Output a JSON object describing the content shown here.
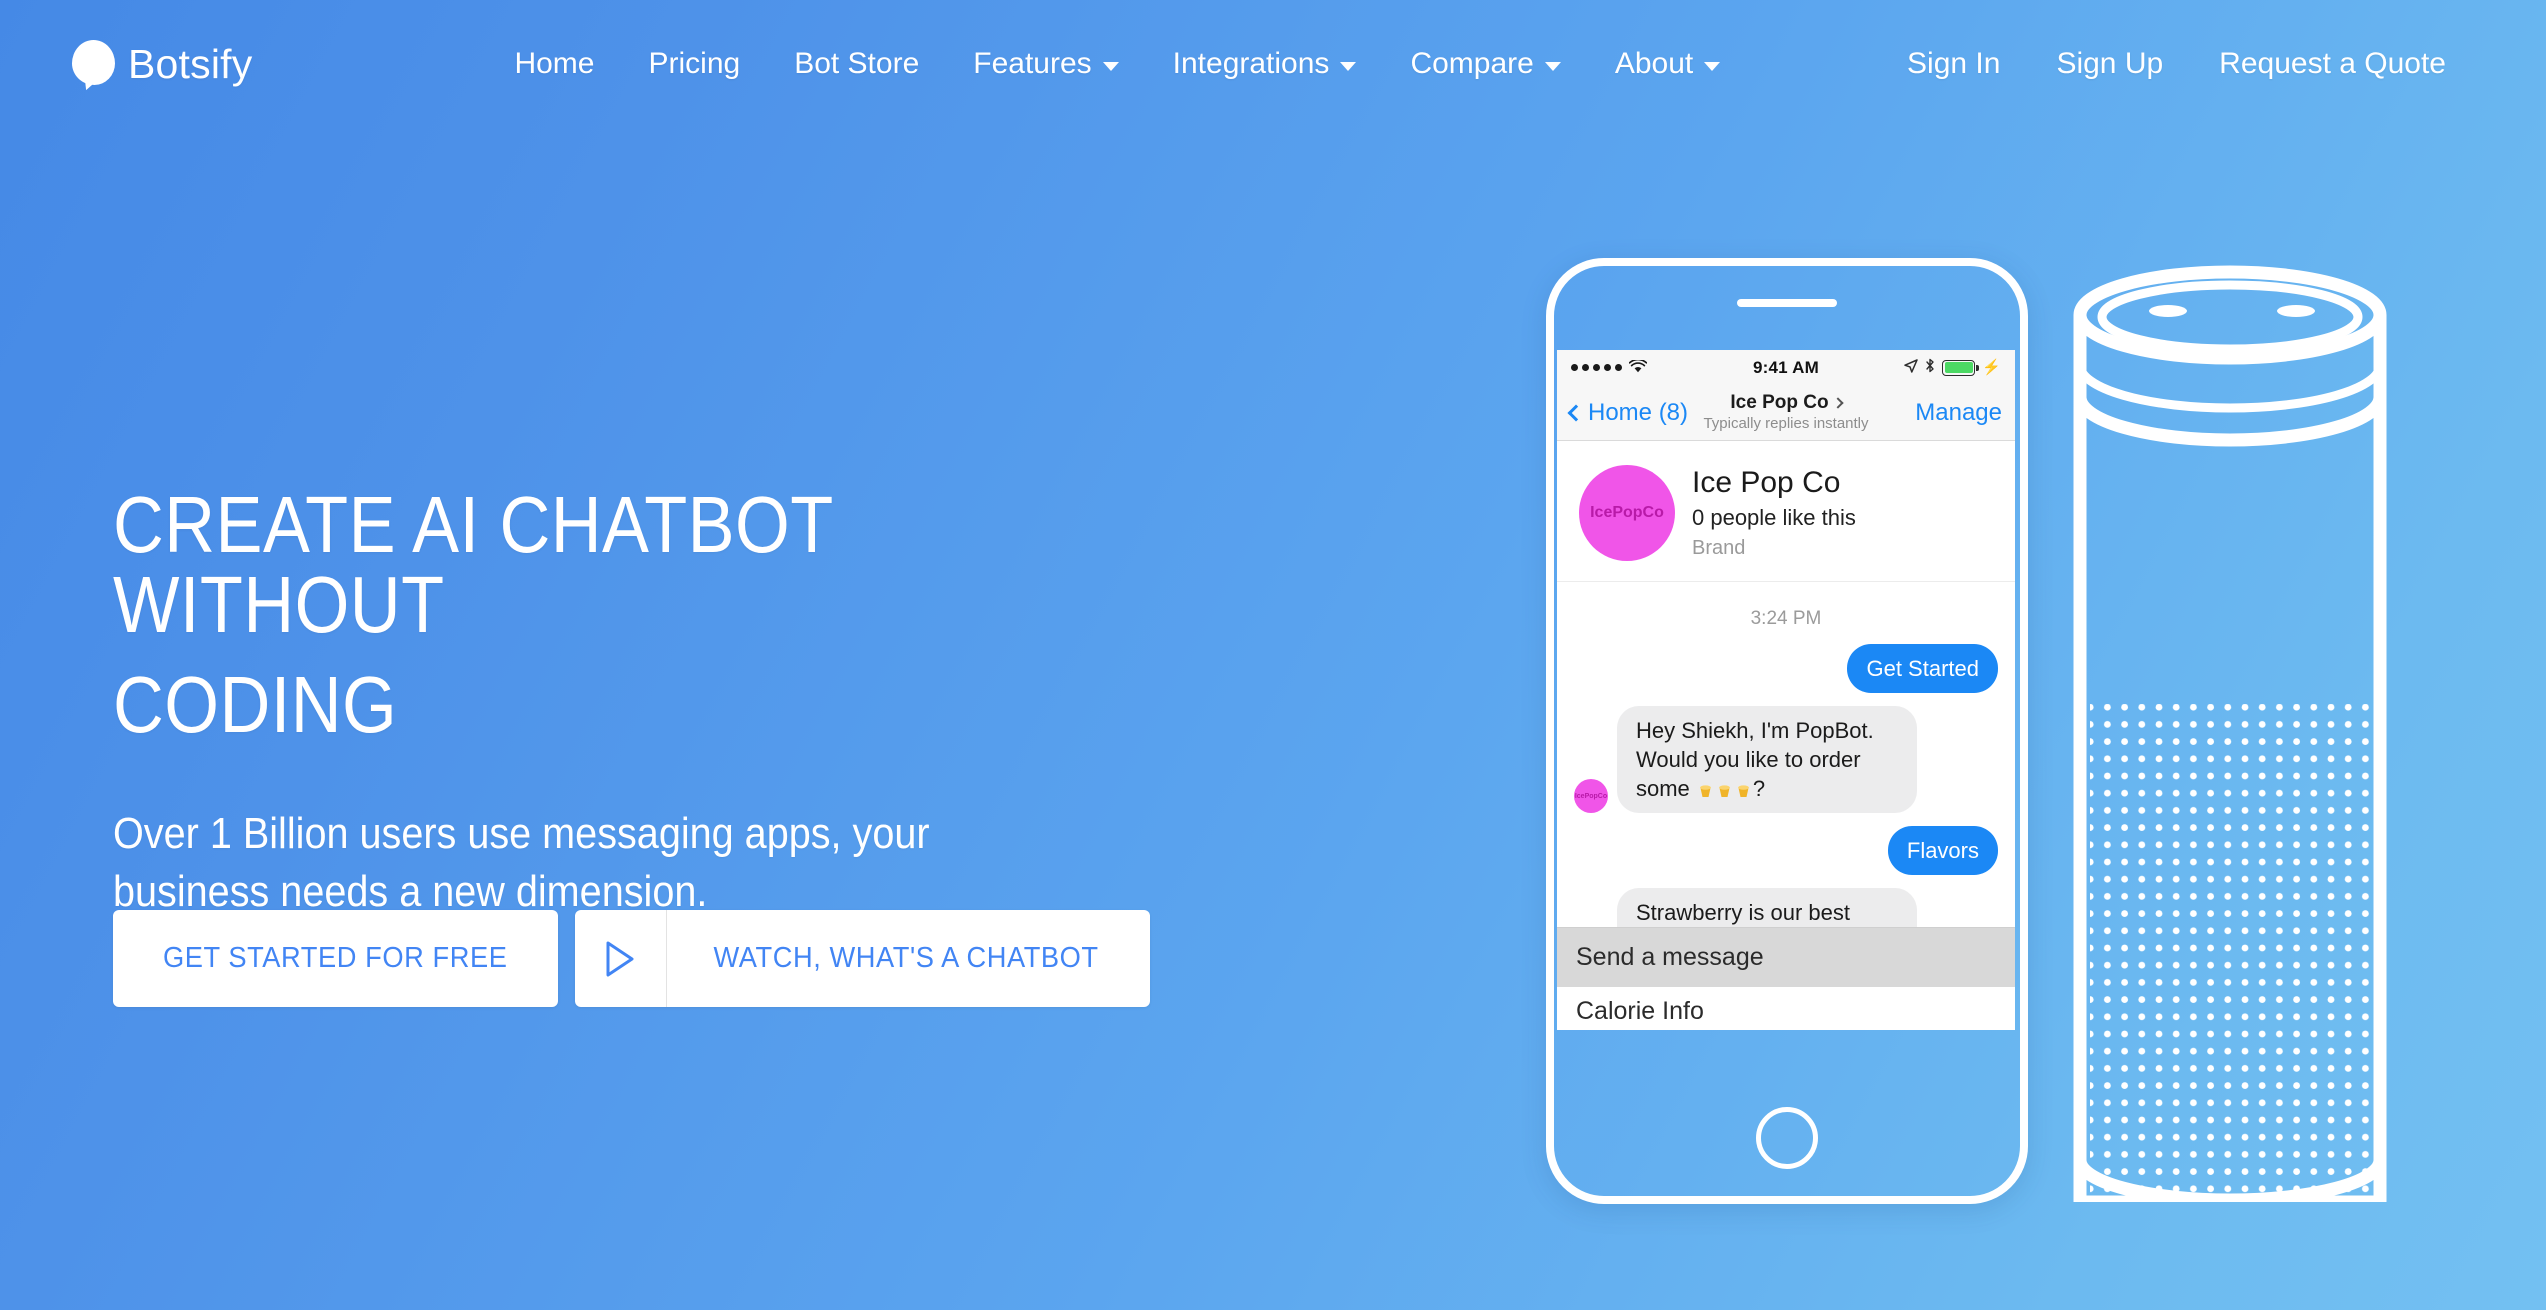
{
  "brand": {
    "name": "Botsify",
    "logo_icon": "chat-bubble-icon"
  },
  "nav": {
    "center_items": [
      {
        "label": "Home",
        "has_dropdown": false
      },
      {
        "label": "Pricing",
        "has_dropdown": false
      },
      {
        "label": "Bot Store",
        "has_dropdown": false
      },
      {
        "label": "Features",
        "has_dropdown": true
      },
      {
        "label": "Integrations",
        "has_dropdown": true
      },
      {
        "label": "Compare",
        "has_dropdown": true
      },
      {
        "label": "About",
        "has_dropdown": true
      }
    ],
    "right_items": [
      {
        "label": "Sign In"
      },
      {
        "label": "Sign Up"
      },
      {
        "label": "Request a Quote"
      }
    ]
  },
  "hero": {
    "headline_line1": "CREATE AI CHATBOT WITHOUT",
    "headline_line2": "CODING",
    "subheadline_line1": "Over 1 Billion users use messaging apps, your",
    "subheadline_line2": "business needs a new dimension.",
    "primary_cta": "GET STARTED FOR FREE",
    "video_cta": "WATCH, WHAT'S A CHATBOT",
    "play_icon": "play-triangle-icon"
  },
  "phone": {
    "status_bar": {
      "signal_dots": 5,
      "wifi_icon": "wifi-icon",
      "time": "9:41 AM",
      "location_icon": "location-arrow-icon",
      "bluetooth_icon": "bluetooth-icon",
      "battery_icon": "battery-icon",
      "charging_icon": "lightning-bolt-icon"
    },
    "messenger_nav": {
      "back_label": "Home (8)",
      "back_icon": "chevron-left-icon",
      "title": "Ice Pop Co",
      "title_chevron": "chevron-right-icon",
      "subtitle": "Typically replies instantly",
      "action_label": "Manage"
    },
    "profile": {
      "avatar_text": "IcePopCo",
      "avatar_color": "#f055e8",
      "name": "Ice Pop Co",
      "likes": "0 people like this",
      "category": "Brand"
    },
    "chat": {
      "timestamp": "3:24 PM",
      "messages": [
        {
          "from": "user",
          "text": "Get Started"
        },
        {
          "from": "bot",
          "text_before": "Hey Shiekh, I'm PopBot. Would you like to order some",
          "emoji_count": 3,
          "text_after": "?",
          "avatar_text": "IcePopCo"
        },
        {
          "from": "user",
          "text": "Flavors"
        },
        {
          "from": "bot",
          "text_before": "Strawberry is our best selling flavour",
          "emoji_count": 0,
          "text_after": "",
          "avatar_text": "IcePopCo"
        }
      ]
    },
    "composer": {
      "input_placeholder": "Send a message",
      "quick_reply": "Calorie Info"
    },
    "home_button_icon": "home-button-icon"
  },
  "echo": {
    "icon": "smart-speaker-icon"
  },
  "colors": {
    "bg_gradient_start": "#4589e6",
    "bg_gradient_end": "#73c0f2",
    "cta_text": "#4285f4",
    "messenger_blue": "#1b88f5",
    "avatar_pink": "#f055e8",
    "battery_green": "#4cd964"
  }
}
